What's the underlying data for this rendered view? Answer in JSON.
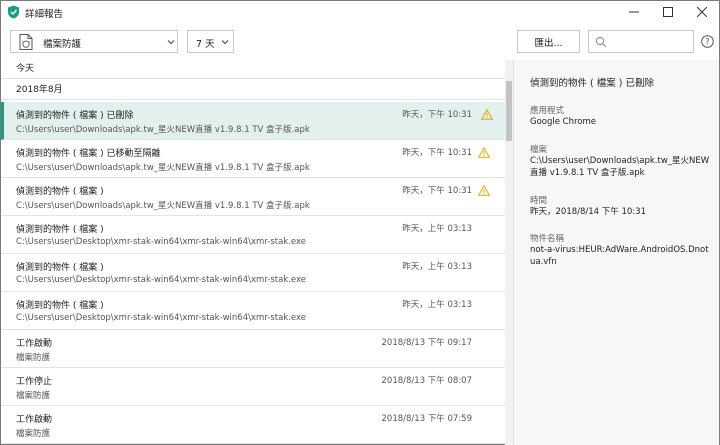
{
  "window": {
    "title": "詳細報告",
    "brand_color": "#1a9c83"
  },
  "toolbar": {
    "component_select": "檔案防護",
    "period_select": "7 天",
    "export_label": "匯出...",
    "search_placeholder": ""
  },
  "list": {
    "groups": [
      {
        "label": "今天"
      },
      {
        "label": "2018年8月"
      }
    ],
    "rows": [
      {
        "title": "偵測到的物件 ( 檔案 ) 已刪除",
        "subtitle": "C:\\Users\\user\\Downloads\\apk.tw_星火NEW直播 v1.9.8.1 TV 盒子版.apk",
        "time": "昨天，下午 10:31",
        "icon": "warning-icon",
        "selected": true
      },
      {
        "title": "偵測到的物件 ( 檔案 ) 已移動至隔離",
        "subtitle": "C:\\Users\\user\\Downloads\\apk.tw_星火NEW直播 v1.9.8.1 TV 盒子版.apk",
        "time": "昨天，下午 10:31",
        "icon": "warning-icon",
        "selected": false
      },
      {
        "title": "偵測到的物件 ( 檔案 )",
        "subtitle": "C:\\Users\\user\\Downloads\\apk.tw_星火NEW直播 v1.9.8.1 TV 盒子版.apk",
        "time": "昨天，下午 10:31",
        "icon": "warning-icon",
        "selected": false
      },
      {
        "title": "偵測到的物件 ( 檔案 )",
        "subtitle": "C:\\Users\\user\\Desktop\\xmr-stak-win64\\xmr-stak-win64\\xmr-stak.exe",
        "time": "昨天，上午 03:13",
        "icon": "",
        "selected": false
      },
      {
        "title": "偵測到的物件 ( 檔案 )",
        "subtitle": "C:\\Users\\user\\Desktop\\xmr-stak-win64\\xmr-stak-win64\\xmr-stak.exe",
        "time": "昨天，上午 03:13",
        "icon": "",
        "selected": false
      },
      {
        "title": "偵測到的物件 ( 檔案 )",
        "subtitle": "C:\\Users\\user\\Desktop\\xmr-stak-win64\\xmr-stak-win64\\xmr-stak.exe",
        "time": "昨天，上午 03:13",
        "icon": "",
        "selected": false
      },
      {
        "title": "工作啟動",
        "subtitle": "檔案防護",
        "time": "2018/8/13 下午 09:17",
        "icon": "",
        "selected": false
      },
      {
        "title": "工作停止",
        "subtitle": "檔案防護",
        "time": "2018/8/13 下午 08:07",
        "icon": "",
        "selected": false
      },
      {
        "title": "工作啟動",
        "subtitle": "檔案防護",
        "time": "2018/8/13 下午 07:59",
        "icon": "",
        "selected": false
      }
    ]
  },
  "details": {
    "title": "偵測到的物件 ( 檔案 ) 已刪除",
    "app_label": "應用程式",
    "app_value": "Google Chrome",
    "file_label": "檔案",
    "file_value": "C:\\Users\\user\\Downloads\\apk.tw_星火NEW直播 v1.9.8.1 TV 盒子版.apk",
    "time_label": "時間",
    "time_value": "昨天，2018/8/14 下午 10:31",
    "object_label": "物件名稱",
    "object_value": "not-a-virus:HEUR:AdWare.AndroidOS.Dnotua.vfn"
  }
}
